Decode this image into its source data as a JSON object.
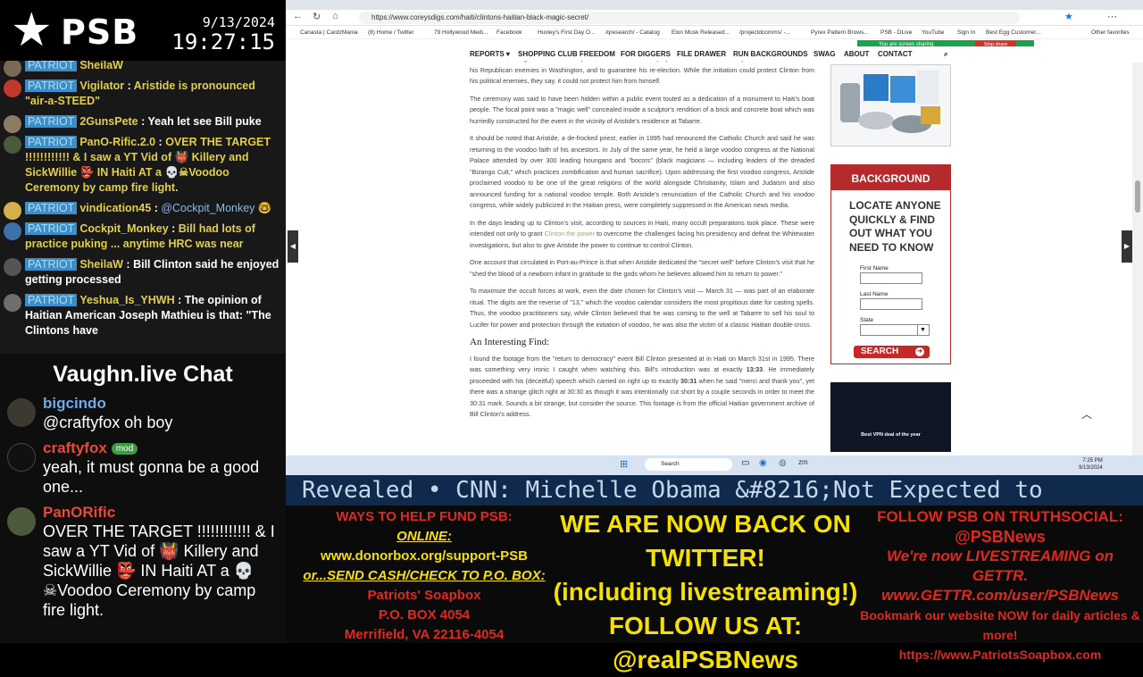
{
  "header": {
    "logo_text": "PSB",
    "date": "9/13/2024",
    "time": "19:27:15"
  },
  "patriot_chat": {
    "badge": "PATRIOT",
    "messages": [
      {
        "user": "SheilaW",
        "text": ""
      },
      {
        "user": "Vigilator",
        "text": "Aristide is pronounced \"air-a-STEED\""
      },
      {
        "user": "2GunsPete",
        "text": "Yeah let see Bill puke"
      },
      {
        "user": "PanO-Rific.2.0",
        "text": "OVER THE TARGET !!!!!!!!!!!! & I saw a YT Vid of 👹 Killery and SickWillie 👺 IN Haiti AT a 💀☠Voodoo Ceremony by camp fire light."
      },
      {
        "user": "vindication45",
        "text": "@Cockpit_Monkey 🤓"
      },
      {
        "user": "Cockpit_Monkey",
        "text": "Bill had lots of practice puking ... anytime HRC was near"
      },
      {
        "user": "SheilaW",
        "text": "Bill Clinton said he enjoyed getting processed"
      },
      {
        "user": "Yeshua_Is_YHWH",
        "text": "The opinion of Haitian American Joseph Mathieu is that: \"The Clintons have"
      }
    ]
  },
  "vaughn_chat": {
    "title": "Vaughn.live Chat",
    "messages": [
      {
        "user": "bigcindo",
        "mod": "",
        "text": "@craftyfox oh boy"
      },
      {
        "user": "craftyfox",
        "mod": "mod",
        "text": "yeah, it must gonna be a good one..."
      },
      {
        "user": "PanORific",
        "mod": "",
        "text": "OVER THE TARGET !!!!!!!!!!!! & I saw a YT Vid of 👹 Killery and SickWillie 👺 IN Haiti AT a 💀☠Voodoo Ceremony by camp fire light."
      }
    ]
  },
  "browser": {
    "url": "https://www.coreysdigs.com/haiti/clintons-haitian-black-magic-secret/",
    "bookmarks": [
      "Canasta | CardzMania",
      "(8) Home / Twitter",
      "79 Hollywood Medi...",
      "Facebook",
      "Huxley's First Day O...",
      "/qresearch/ - Catalog",
      "Elon Musk Released...",
      "/projectdcomms/ -...",
      "Pyrex Pattern Brows...",
      "PSB - DLive",
      "YouTube",
      "Sign In",
      "Best Egg Customer...",
      "Other favorites"
    ],
    "sharing_text": "You are screen sharing",
    "stop_share": "Stop share"
  },
  "site_nav": [
    "REPORTS ▾",
    "SHOPPING CLUB FREEDOM",
    "FOR DIGGERS",
    "FILE DRAWER",
    "RUN BACKGROUNDS",
    "SWAG",
    "ABOUT",
    "CONTACT"
  ],
  "article": {
    "p0": "stated that installing Clinton under the power of voodoo had two purposes — to render him impervious to the attacks of his Republican enemies in Washington, and to guarantee his re-election. While the initiation could protect Clinton from his political enemies, they say, it could not protect him from himself.",
    "p1": "The ceremony was said to have been hidden within a public event touted as a dedication of a monument to Haiti's boat people. The focal point was a \"magic well\" concealed inside a sculptor's rendition of a brick and concrete boat which was hurriedly constructed for the event in the vicinity of Aristide's residence at Tabarre.",
    "p2": "It should be noted that Aristide, a de-frocked priest, earlier in 1995 had renounced the Catholic Church and said he was returning to the voodoo faith of his ancestors. In July of the same year, he held a large voodoo congress at the National Palace attended by over 300 leading houngans and \"bocors\" (black magicians — including leaders of the dreaded \"Bizango Cult,\" which practices zombification and human sacrifice). Upon addressing the first voodoo congress, Aristide proclaimed voodoo to be one of the great religions of the world alongside Christianity, Islam and Judaism and also announced funding for a national voodoo temple. Both Aristide's renunciation of the Catholic Church and his voodoo congress, while widely publicized in the Haitian press, were completely suppressed in the American news media.",
    "p3a": "In the days leading up to Clinton's visit, according to sources in Haiti, many occult preparations took place. These were intended not only to grant ",
    "p3link": "Clinton the power",
    "p3b": " to overcome the challenges facing his presidency and defeat the Whitewater investigations, but also to give Aristide the power to continue to control Clinton.",
    "p4": "One account that circulated in Port-au-Prince is that when Aristide dedicated the \"secret well\" before Clinton's visit that he \"shed the blood of a newborn infant in gratitude to the gods whom he believes allowed him to return to power.\"",
    "p5": "To maximize the occult forces at work, even the date chosen for Clinton's visit — March 31 — was part of an elaborate ritual. The digits are the reverse of \"13,\" which the voodoo calendar considers the most propitious date for casting spells. Thus, the voodoo practitioners say, while Clinton believed that he was coming to the well at Tabarre to sell his soul to Lucifer for power and protection through the initiation of voodoo, he was also the victim of a classic Haitian double-cross.",
    "heading": "An Interesting Find:",
    "p6a": "I found the footage from the \"return to democracy\" event Bill Clinton presented at in Haiti on March 31st in 1995. There was something very ironic I caught when watching this. Bill's introduction was at exactly ",
    "p6b1": "13:33",
    "p6c": ". He immediately proceeded with his (deceitful) speech which carried on right up to exactly ",
    "p6b2": "30:31",
    "p6d": " when he said \"merci and thank you\", yet there was a strange glitch right at 30:30 as though it was intentionally cut short by a couple seconds in order to meet the 30:31 mark. Sounds a bit strange, but consider the source. This footage is from the official Haitian government archive of Bill Clinton's address."
  },
  "sidebar": {
    "bg_title": "BACKGROUND SEARCH",
    "bg_sub": "LOCATE ANYONE QUICKLY & FIND OUT WHAT YOU NEED TO KNOW",
    "first_name": "First Name",
    "last_name": "Last Name",
    "state": "State",
    "search_btn": "SEARCH",
    "vpn": "Best VPN deal of the year"
  },
  "taskbar": {
    "search": "Search",
    "time": "7:25 PM",
    "date": "9/13/2024"
  },
  "ticker": "Revealed   •   CNN: Michelle Obama &#8216;Not Expected to",
  "bottom": {
    "fund_title": "WAYS TO HELP FUND PSB:",
    "online": "ONLINE:",
    "donor": "www.donorbox.org/support-PSB",
    "or_send": "or...SEND CASH/CHECK TO P.O. BOX:",
    "addr1": "Patriots' Soapbox",
    "addr2": "P.O. BOX 4054",
    "addr3": "Merrifield, VA 22116-4054",
    "twitter1": "WE ARE NOW BACK ON TWITTER!",
    "twitter2": "(including livestreaming!)",
    "twitter3": "FOLLOW US AT:",
    "twitter4": "@realPSBNews",
    "truth1": "FOLLOW PSB ON TRUTHSOCIAL:",
    "truth2": "@PSBNews",
    "gettr1": "We're now LIVESTREAMING on GETTR.",
    "gettr2": "www.GETTR.com/user/PSBNews",
    "web1": "Bookmark our website NOW for daily articles & more!",
    "web2": "https://www.PatriotsSoapbox.com"
  },
  "colors": {
    "patriot_badge": "#3a8fc9",
    "username_gold": "#e2cf48",
    "brand_red": "#b52a2a",
    "fund_red": "#e0281e",
    "twitter_yellow": "#f6e000",
    "ticker_bg": "#102a4e"
  }
}
